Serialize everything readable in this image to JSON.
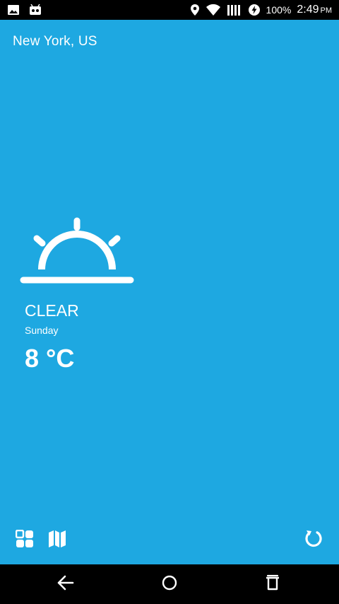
{
  "status_bar": {
    "battery": "100%",
    "time": "2:49",
    "ampm": "PM",
    "icons": [
      "gallery-icon",
      "android-debug-icon",
      "location-icon",
      "wifi-icon",
      "signal-icon",
      "battery-saver-icon"
    ]
  },
  "weather": {
    "location": "New York, US",
    "condition": "CLEAR",
    "day": "Sunday",
    "temperature": "8 °C",
    "icon": "sunrise-icon"
  },
  "toolbar": {
    "icons": [
      "apps-icon",
      "map-icon",
      "refresh-icon"
    ]
  },
  "navigation": {
    "icons": [
      "back-icon",
      "home-icon",
      "recents-icon"
    ]
  },
  "colors": {
    "background": "#1ea8e1",
    "foreground": "#ffffff",
    "bars": "#000000"
  }
}
